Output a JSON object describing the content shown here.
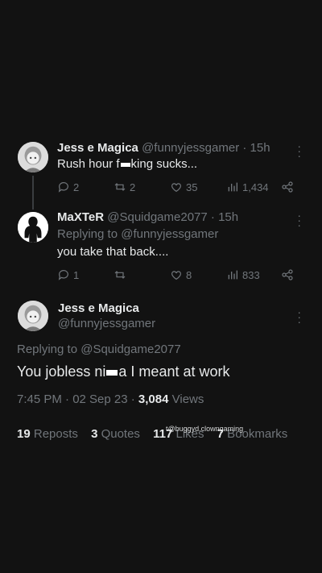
{
  "reply1": {
    "name": "Jess e Magica",
    "handle": "@funnyjessgamer",
    "time": "· 15h",
    "text_before": "Rush hour f",
    "text_after": "king sucks...",
    "replies": "2",
    "reposts": "2",
    "likes": "35",
    "views": "1,434"
  },
  "reply2": {
    "name": "MaXTeR",
    "handle": "@Squidgame2077",
    "time": "· 15h",
    "replying_prefix": "Replying to ",
    "replying_to": "@funnyjessgamer",
    "text": "you take that back....",
    "replies": "1",
    "reposts": "",
    "likes": "8",
    "views": "833"
  },
  "main": {
    "name": "Jess e Magica",
    "handle": "@funnyjessgamer",
    "replying_prefix": "Replying to ",
    "replying_to": "@Squidgame2077",
    "text_before": "You jobless ni",
    "text_after": "a I meant at work",
    "time_date": "7:45 PM · 02 Sep 23 · ",
    "views_count": "3,084",
    "views_label": " Views"
  },
  "stats": {
    "reposts_count": "19",
    "reposts_label": " Reposts",
    "quotes_count": "3",
    "quotes_label": " Quotes",
    "likes_count": "117",
    "likes_label": " Likes",
    "bookmarks_count": "7",
    "bookmarks_label": " Bookmarks"
  },
  "watermark": "t@buggyd.clowngaming",
  "colors": {
    "background": "#121212",
    "text": "#e7e9ea",
    "muted": "#71767b"
  }
}
